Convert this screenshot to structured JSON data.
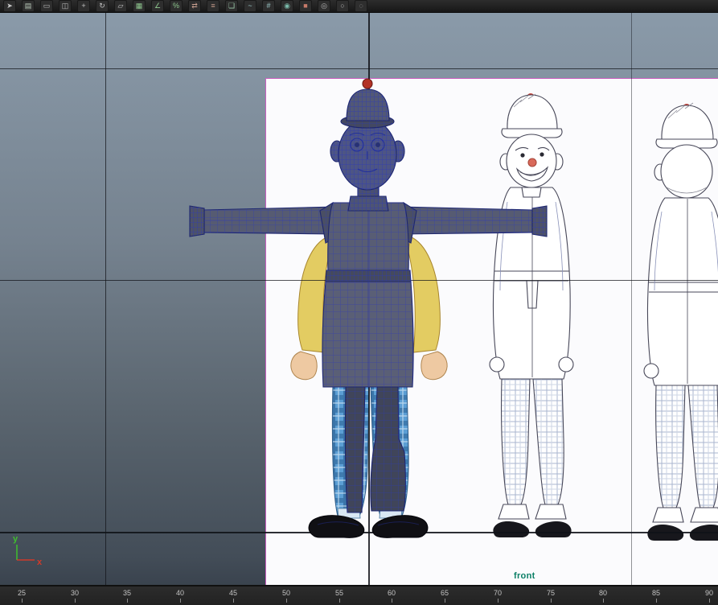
{
  "toolbar": {
    "icons": [
      {
        "name": "select-object-icon",
        "glyph": "➤",
        "color": "#c8c8c8"
      },
      {
        "name": "select-by-name-icon",
        "glyph": "▤",
        "color": "#b9c9b9"
      },
      {
        "name": "selection-region-icon",
        "glyph": "▭",
        "color": "#bdbdbd"
      },
      {
        "name": "window-crossing-icon",
        "glyph": "◫",
        "color": "#bdbdbd"
      },
      {
        "name": "move-icon",
        "glyph": "+",
        "color": "#c4c4c4"
      },
      {
        "name": "rotate-icon",
        "glyph": "↻",
        "color": "#c4c4c4"
      },
      {
        "name": "scale-icon",
        "glyph": "▱",
        "color": "#c4c4c4"
      },
      {
        "name": "snap-toggle-icon",
        "glyph": "▦",
        "color": "#8ec78e"
      },
      {
        "name": "angle-snap-icon",
        "glyph": "∠",
        "color": "#8ec78e"
      },
      {
        "name": "percent-snap-icon",
        "glyph": "%",
        "color": "#8ec78e"
      },
      {
        "name": "mirror-icon",
        "glyph": "⇄",
        "color": "#c9a090"
      },
      {
        "name": "align-icon",
        "glyph": "≡",
        "color": "#c49a8a"
      },
      {
        "name": "layer-manager-icon",
        "glyph": "❏",
        "color": "#9cc9a8"
      },
      {
        "name": "curve-editor-icon",
        "glyph": "~",
        "color": "#9cc9c9"
      },
      {
        "name": "schematic-view-icon",
        "glyph": "#",
        "color": "#9cc9c9"
      },
      {
        "name": "material-editor-icon",
        "glyph": "◉",
        "color": "#79b9a9"
      },
      {
        "name": "render-setup-icon",
        "glyph": "■",
        "color": "#c77a6a"
      },
      {
        "name": "pivot-icon",
        "glyph": "◎",
        "color": "#b5b5b5"
      },
      {
        "name": "lock-selection-icon",
        "glyph": "○",
        "color": "#b5b5b5"
      },
      {
        "name": "named-sets-icon",
        "glyph": "◌",
        "color": "#b5b5b5"
      }
    ]
  },
  "viewport": {
    "view_label": "front",
    "axis_gizmo": {
      "x": "x",
      "y": "y"
    }
  },
  "timeline": {
    "ticks": [
      "25",
      "30",
      "35",
      "40",
      "45",
      "50",
      "55",
      "60",
      "65",
      "70",
      "75",
      "80",
      "85",
      "90"
    ]
  },
  "colors": {
    "selection_outline": "#c95fc0",
    "view_label": "#0b7f66",
    "axis_x": "#d03a2a",
    "axis_y": "#3fbf2e",
    "wireframe": "#2c39bb",
    "grid_line": "#101218",
    "reference_bg": "#fbfbfd"
  }
}
